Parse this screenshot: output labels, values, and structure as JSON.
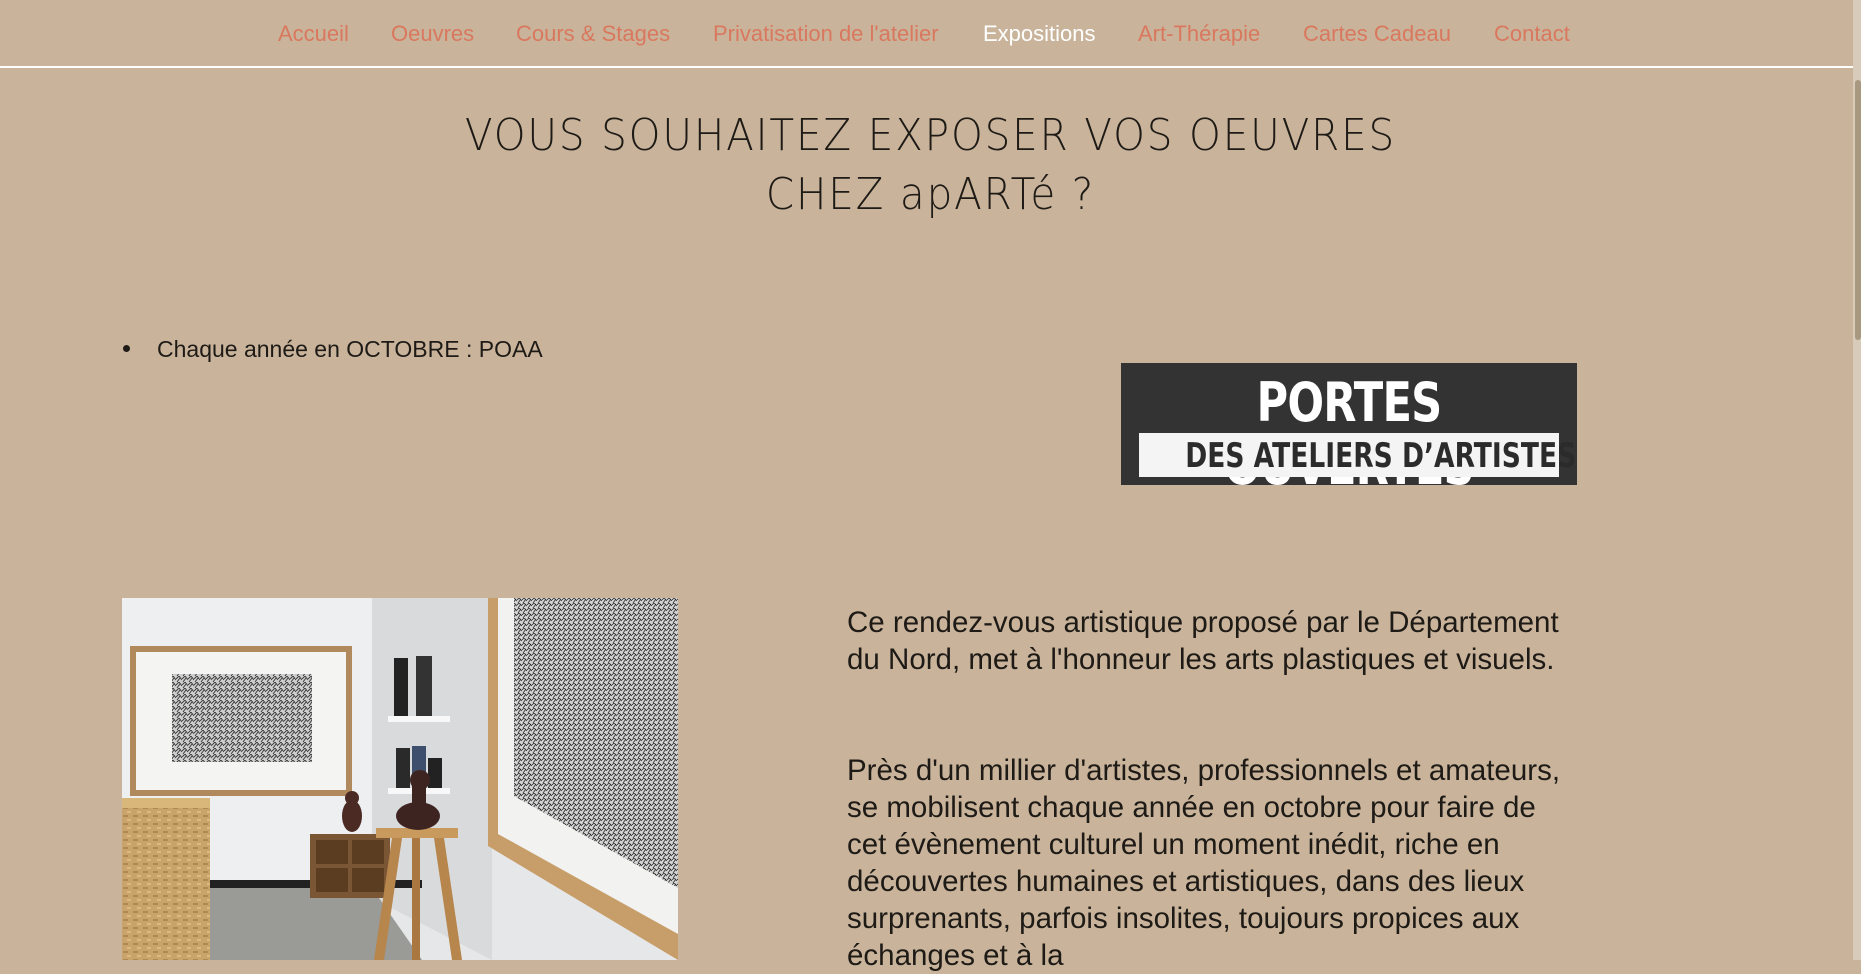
{
  "nav": {
    "items": [
      {
        "label": "Accueil"
      },
      {
        "label": "Oeuvres"
      },
      {
        "label": "Cours & Stages"
      },
      {
        "label": "Privatisation de l'atelier"
      },
      {
        "label": "Expositions",
        "active": true
      },
      {
        "label": "Art-Thérapie"
      },
      {
        "label": "Cartes Cadeau"
      },
      {
        "label": "Contact"
      }
    ]
  },
  "heading": {
    "line1": "VOUS SOUHAITEZ EXPOSER VOS OEUVRES",
    "line2": "CHEZ apARTé ?"
  },
  "bullet": {
    "text": "Chaque année en OCTOBRE : POAA"
  },
  "logo": {
    "line1": "PORTES OUVERTES",
    "line2": "DES ATELIERS D’ARTISTES"
  },
  "content": {
    "paragraph1": "Ce rendez-vous artistique proposé par le Département du Nord, met à l'honneur les arts plastiques et visuels.",
    "paragraph2": "Près d'un millier d'artistes, professionnels et amateurs, se mobilisent chaque année en octobre pour faire de cet évènement culturel un moment inédit, riche en découvertes humaines et artistiques, dans des lieux surprenants, parfois insolites, toujours propices aux échanges et à la"
  },
  "colors": {
    "background": "#c9b49b",
    "nav_link": "#d9785e",
    "nav_active": "#ffffff",
    "text": "#1e1a16"
  }
}
